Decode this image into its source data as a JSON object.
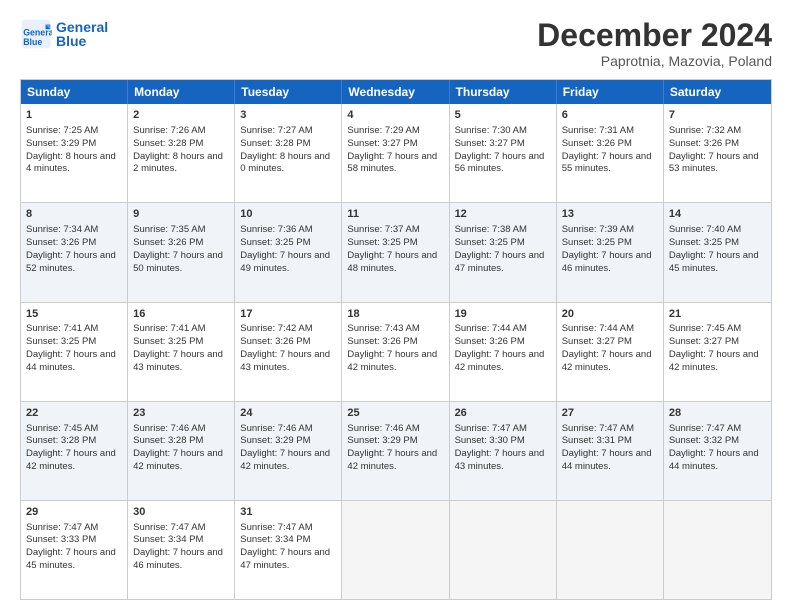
{
  "logo": {
    "line1": "General",
    "line2": "Blue"
  },
  "title": "December 2024",
  "subtitle": "Paprotnia, Mazovia, Poland",
  "days": [
    "Sunday",
    "Monday",
    "Tuesday",
    "Wednesday",
    "Thursday",
    "Friday",
    "Saturday"
  ],
  "weeks": [
    [
      {
        "day": "1",
        "rise": "7:25 AM",
        "set": "3:29 PM",
        "hours": "8 hours and 4 minutes"
      },
      {
        "day": "2",
        "rise": "7:26 AM",
        "set": "3:28 PM",
        "hours": "8 hours and 2 minutes"
      },
      {
        "day": "3",
        "rise": "7:27 AM",
        "set": "3:28 PM",
        "hours": "8 hours and 0 minutes"
      },
      {
        "day": "4",
        "rise": "7:29 AM",
        "set": "3:27 PM",
        "hours": "7 hours and 58 minutes"
      },
      {
        "day": "5",
        "rise": "7:30 AM",
        "set": "3:27 PM",
        "hours": "7 hours and 56 minutes"
      },
      {
        "day": "6",
        "rise": "7:31 AM",
        "set": "3:26 PM",
        "hours": "7 hours and 55 minutes"
      },
      {
        "day": "7",
        "rise": "7:32 AM",
        "set": "3:26 PM",
        "hours": "7 hours and 53 minutes"
      }
    ],
    [
      {
        "day": "8",
        "rise": "7:34 AM",
        "set": "3:26 PM",
        "hours": "7 hours and 52 minutes"
      },
      {
        "day": "9",
        "rise": "7:35 AM",
        "set": "3:26 PM",
        "hours": "7 hours and 50 minutes"
      },
      {
        "day": "10",
        "rise": "7:36 AM",
        "set": "3:25 PM",
        "hours": "7 hours and 49 minutes"
      },
      {
        "day": "11",
        "rise": "7:37 AM",
        "set": "3:25 PM",
        "hours": "7 hours and 48 minutes"
      },
      {
        "day": "12",
        "rise": "7:38 AM",
        "set": "3:25 PM",
        "hours": "7 hours and 47 minutes"
      },
      {
        "day": "13",
        "rise": "7:39 AM",
        "set": "3:25 PM",
        "hours": "7 hours and 46 minutes"
      },
      {
        "day": "14",
        "rise": "7:40 AM",
        "set": "3:25 PM",
        "hours": "7 hours and 45 minutes"
      }
    ],
    [
      {
        "day": "15",
        "rise": "7:41 AM",
        "set": "3:25 PM",
        "hours": "7 hours and 44 minutes"
      },
      {
        "day": "16",
        "rise": "7:41 AM",
        "set": "3:25 PM",
        "hours": "7 hours and 43 minutes"
      },
      {
        "day": "17",
        "rise": "7:42 AM",
        "set": "3:26 PM",
        "hours": "7 hours and 43 minutes"
      },
      {
        "day": "18",
        "rise": "7:43 AM",
        "set": "3:26 PM",
        "hours": "7 hours and 42 minutes"
      },
      {
        "day": "19",
        "rise": "7:44 AM",
        "set": "3:26 PM",
        "hours": "7 hours and 42 minutes"
      },
      {
        "day": "20",
        "rise": "7:44 AM",
        "set": "3:27 PM",
        "hours": "7 hours and 42 minutes"
      },
      {
        "day": "21",
        "rise": "7:45 AM",
        "set": "3:27 PM",
        "hours": "7 hours and 42 minutes"
      }
    ],
    [
      {
        "day": "22",
        "rise": "7:45 AM",
        "set": "3:28 PM",
        "hours": "7 hours and 42 minutes"
      },
      {
        "day": "23",
        "rise": "7:46 AM",
        "set": "3:28 PM",
        "hours": "7 hours and 42 minutes"
      },
      {
        "day": "24",
        "rise": "7:46 AM",
        "set": "3:29 PM",
        "hours": "7 hours and 42 minutes"
      },
      {
        "day": "25",
        "rise": "7:46 AM",
        "set": "3:29 PM",
        "hours": "7 hours and 42 minutes"
      },
      {
        "day": "26",
        "rise": "7:47 AM",
        "set": "3:30 PM",
        "hours": "7 hours and 43 minutes"
      },
      {
        "day": "27",
        "rise": "7:47 AM",
        "set": "3:31 PM",
        "hours": "7 hours and 44 minutes"
      },
      {
        "day": "28",
        "rise": "7:47 AM",
        "set": "3:32 PM",
        "hours": "7 hours and 44 minutes"
      }
    ],
    [
      {
        "day": "29",
        "rise": "7:47 AM",
        "set": "3:33 PM",
        "hours": "7 hours and 45 minutes"
      },
      {
        "day": "30",
        "rise": "7:47 AM",
        "set": "3:34 PM",
        "hours": "7 hours and 46 minutes"
      },
      {
        "day": "31",
        "rise": "7:47 AM",
        "set": "3:34 PM",
        "hours": "7 hours and 47 minutes"
      },
      null,
      null,
      null,
      null
    ]
  ],
  "labels": {
    "sunrise": "Sunrise:",
    "sunset": "Sunset:",
    "daylight": "Daylight:"
  }
}
